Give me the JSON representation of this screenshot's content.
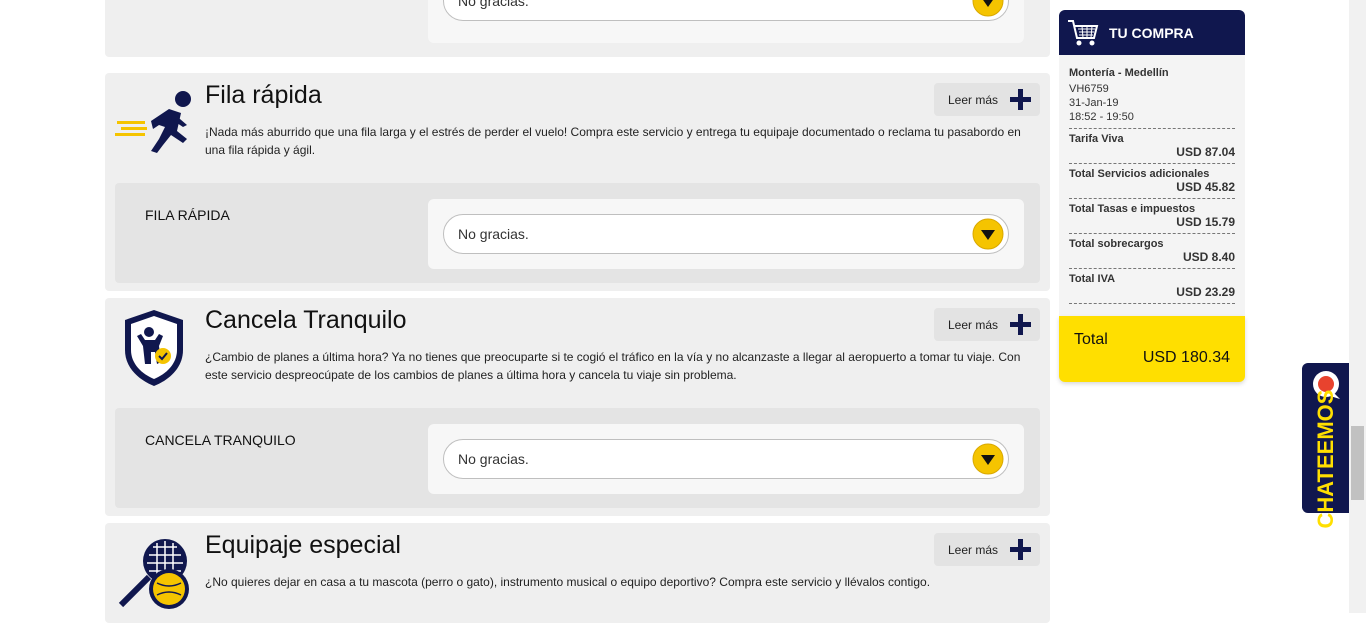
{
  "colors": {
    "navy": "#10174e",
    "yellow": "#ffdf00",
    "card": "#efefef"
  },
  "top_card": {
    "select_value": "No gracias."
  },
  "cards": [
    {
      "title": "Fila rápida",
      "desc": "¡Nada más aburrido que una fila larga y el estrés de perder el vuelo! Compra este servicio y entrega tu equipaje documentado o reclama tu pasabordo en una fila rápida y ágil.",
      "read_more": "Leer más",
      "option_label": "FILA RÁPIDA",
      "select_value": "No gracias.",
      "icon": "running-person-icon"
    },
    {
      "title": "Cancela Tranquilo",
      "desc": "¿Cambio de planes a última hora? Ya no tienes que preocuparte si te cogió el tráfico en la vía y no alcanzaste a llegar al aeropuerto a tomar tu viaje. Con este servicio despreocúpate de los cambios de planes a última hora y cancela tu viaje sin problema.",
      "read_more": "Leer más",
      "option_label": "CANCELA TRANQUILO",
      "select_value": "No gracias.",
      "icon": "shield-person-icon"
    },
    {
      "title": "Equipaje especial",
      "desc": "¿No quieres dejar en casa a tu mascota (perro o gato), instrumento musical o equipo deportivo? Compra este servicio y llévalos contigo.",
      "read_more": "Leer más",
      "icon": "racket-ball-icon"
    }
  ],
  "cart": {
    "title": "TU COMPRA",
    "route": "Montería - Medellín",
    "flight": "VH6759",
    "date": "31-Jan-19",
    "time": "18:52 - 19:50",
    "rows": [
      {
        "label": "Tarifa Viva",
        "value": "USD 87.04"
      },
      {
        "label": "Total Servicios adicionales",
        "value": "USD 45.82"
      },
      {
        "label": "Total Tasas e impuestos",
        "value": "USD 15.79"
      },
      {
        "label": "Total sobrecargos",
        "value": "USD 8.40"
      },
      {
        "label": "Total IVA",
        "value": "USD 23.29"
      }
    ],
    "total_label": "Total",
    "total_value": "USD 180.34"
  },
  "chat": {
    "label": "CHATEEMOS"
  }
}
